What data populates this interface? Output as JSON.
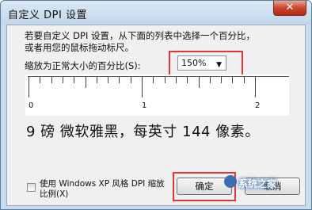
{
  "window": {
    "title": "自定义 DPI 设置",
    "close_glyph": "✕"
  },
  "description": [
    "若要自定义 DPI 设置，从下面的列表中选择一个百分比，",
    "或者用您的鼠标拖动标尺。"
  ],
  "scale": {
    "label": "缩放为正常大小的百分比(S):",
    "value": "150%",
    "caret": "▼"
  },
  "ruler": {
    "labels": [
      "0",
      "1",
      "2"
    ]
  },
  "sample_text": "9 磅 微软雅黑，每英寸 144 像素。",
  "xp_option": {
    "label": "使用 Windows XP 风格 DPI 缩放比例(X)",
    "checked": false
  },
  "buttons": {
    "ok": "确定",
    "cancel": "取消"
  },
  "watermark": "系统之家",
  "highlight_color": "#e53438"
}
